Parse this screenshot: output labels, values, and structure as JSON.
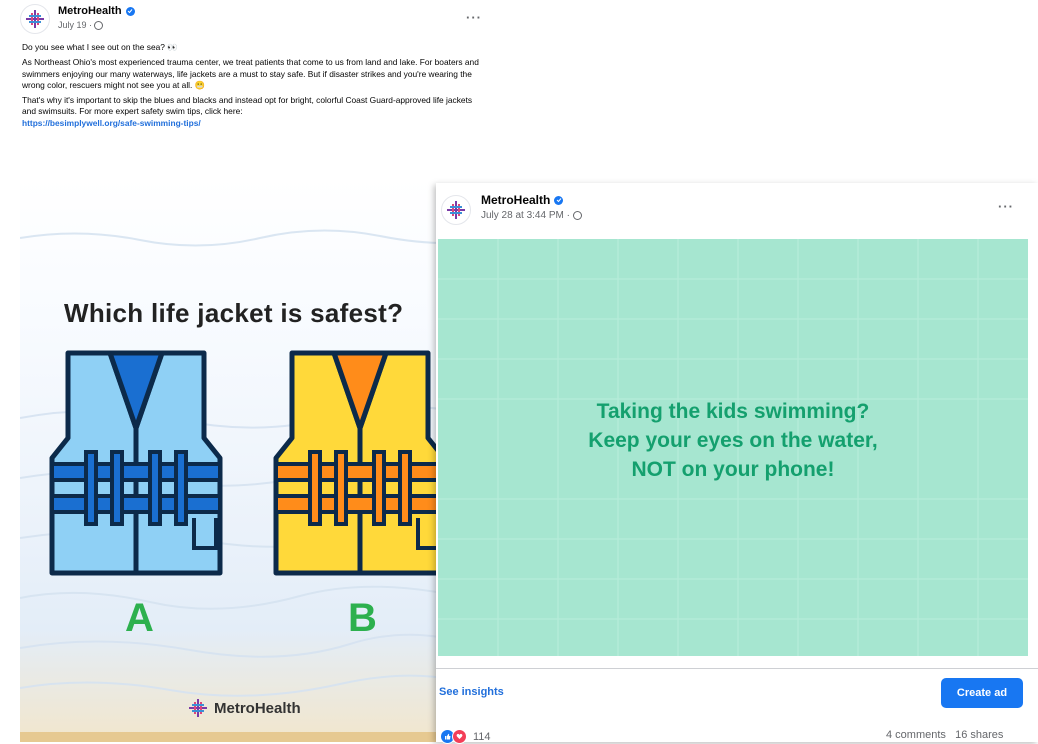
{
  "post1": {
    "author": "MetroHealth",
    "date": "July 19 · ",
    "intro": "Do you see what I see out on the sea? 👀",
    "body": "As Northeast Ohio's most experienced trauma center, we treat patients that come to us from land and lake. For boaters and swimmers enjoying our many waterways, life jackets are a must to stay safe. But if disaster strikes and you're wearing the wrong color, rescuers might not see you at all. 😬",
    "body2": "That's why it's important to skip the blues and blacks and instead opt for bright, colorful Coast Guard-approved life jackets and swimsuits. For more expert safety swim tips, click here:",
    "link": "https://besimplywell.org/safe-swimming-tips/",
    "image": {
      "headline": "Which life jacket is safest?",
      "option_a": "A",
      "option_b": "B",
      "logo_text": "MetroHealth",
      "colors": {
        "jacket_a": "#8fd0f5",
        "jacket_a_dark": "#1a6fd1",
        "jacket_b": "#ffd93a",
        "jacket_b_dark": "#ff8c1a",
        "letter": "#2db04e"
      }
    }
  },
  "post2": {
    "author": "MetroHealth",
    "date": "July 28 at 3:44 PM · ",
    "image": {
      "lines": [
        "Taking the kids swimming?",
        "Keep your eyes on the water,",
        "NOT on your phone!"
      ],
      "colors": {
        "background": "#a6e6d0",
        "text": "#14a06e"
      }
    },
    "see_insights": "See insights",
    "create_ad": "Create ad",
    "reaction_count": "114",
    "comments": "4 comments",
    "shares": "16 shares"
  },
  "icons": [
    "metrohealth-logo-icon",
    "verified-badge-icon",
    "globe-icon",
    "more-options-icon",
    "like-reaction-icon",
    "love-reaction-icon"
  ],
  "accent_color": "#1877f2"
}
